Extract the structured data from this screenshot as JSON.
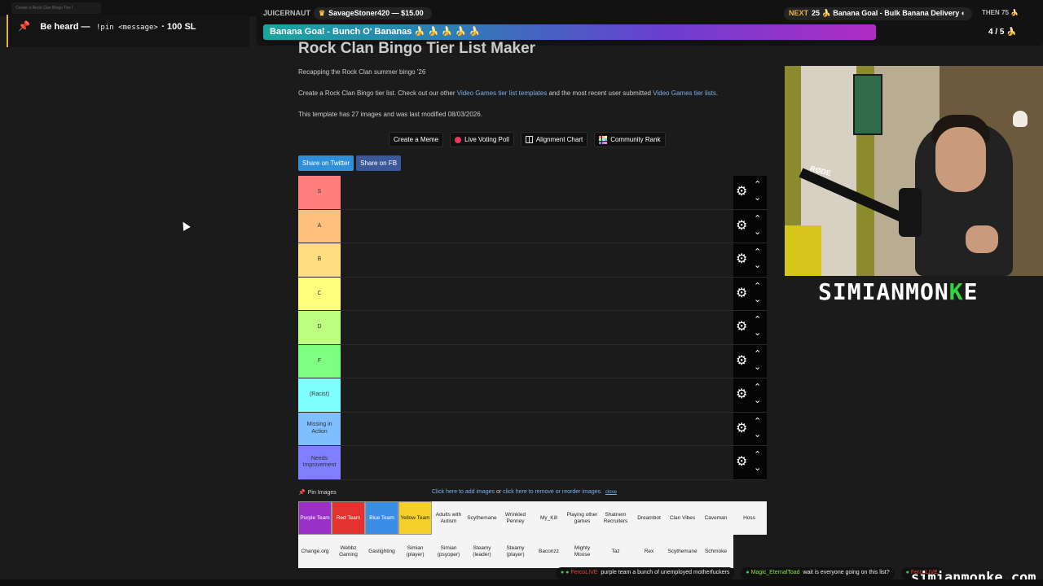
{
  "browser": {
    "tab_title": "Create a Rock Clan Bingo Tier l"
  },
  "pin": {
    "label": "Be heard —",
    "command": "!pin <message>",
    "cost": "· 100 SL"
  },
  "stream_bar": {
    "juice_label": "JUICERNAUT",
    "juice_user": "SavageStoner420 — $15.00",
    "next_tag": "NEXT",
    "next_text": "25 🍌 Banana Goal - Bulk Banana Delivery ◐",
    "then_text": "THEN   75 🍌",
    "goal_text": "Banana Goal - Bunch O' Bananas 🍌 🍌 🍌 🍌 🍌",
    "goal_count": "4 / 5 🍌",
    "goal_progress": 0.8
  },
  "page": {
    "title": "Rock Clan Bingo Tier List Maker",
    "subtitle": "Recapping the Rock Clan summer bingo '26",
    "desc_1": "Create a Rock Clan Bingo tier list. Check out our other ",
    "desc_link_1": "Video Games tier list templates",
    "desc_2": " and the most recent user submitted ",
    "desc_link_2": "Video Games tier lists",
    "desc_3": ".",
    "meta": "This template has 27 images and was last modified 08/03/2026."
  },
  "actions": {
    "create_meme": "Create a Meme",
    "live_poll": "Live Voting Poll",
    "alignment": "Alignment Chart",
    "community": "Community Rank"
  },
  "share": {
    "twitter": "Share on Twitter",
    "fb": "Share on FB"
  },
  "tiers": [
    {
      "label": "S",
      "color": "#ff7f7f"
    },
    {
      "label": "A",
      "color": "#ffbf7f"
    },
    {
      "label": "B",
      "color": "#ffdf7f"
    },
    {
      "label": "C",
      "color": "#ffff7f"
    },
    {
      "label": "D",
      "color": "#bfff7f"
    },
    {
      "label": "F",
      "color": "#7fff7f"
    },
    {
      "label": "(Racist)",
      "color": "#7fffff"
    },
    {
      "label": "Missing in Action",
      "color": "#7fbfff"
    },
    {
      "label": "Needs Improvement",
      "color": "#7f7fff"
    }
  ],
  "icons": {
    "gear": "gear-icon",
    "up": "chevron-up-icon",
    "down": "chevron-down-icon",
    "pin": "pin-icon"
  },
  "bank": {
    "pin_label": "Pin Images",
    "add_link": "Click here to add images",
    "or": " or ",
    "reorder_link": "click here to remove or reorder images.",
    "close": "close",
    "row1": [
      {
        "label": "Purple Team",
        "color": "#9b30c9"
      },
      {
        "label": "Red Team",
        "color": "#e4332f"
      },
      {
        "label": "Blue Team",
        "color": "#3b8ee6"
      },
      {
        "label": "Yellow Team",
        "color": "#f5d02a"
      },
      {
        "label": "Adults with Autism",
        "color": ""
      },
      {
        "label": "Scythemane",
        "color": ""
      },
      {
        "label": "Wrinkled Penney",
        "color": ""
      },
      {
        "label": "My_Kill",
        "color": ""
      },
      {
        "label": "Playing other games",
        "color": ""
      },
      {
        "label": "Shatnem Recruiters",
        "color": ""
      },
      {
        "label": "Dreambot",
        "color": ""
      },
      {
        "label": "Clan Vibes",
        "color": ""
      },
      {
        "label": "Caveman",
        "color": ""
      },
      {
        "label": "Hoss",
        "color": ""
      }
    ],
    "row2": [
      "Change.org",
      "Webbz Gaming",
      "Gaslighting",
      "Simian (player)",
      "Simian (psyoper)",
      "Steamy (leader)",
      "Steamy (player)",
      "Baconzz",
      "Mighty Moose",
      "Taz",
      "Rex",
      "Scythemane",
      "Schmoke"
    ]
  },
  "webcam": {
    "mic_brand": "RØDE"
  },
  "brand": {
    "main": "SIMIANMON",
    "accent": "K",
    "end": "E",
    "site": "simianmonke.com"
  },
  "ticker": [
    {
      "user": "FercoLIVE",
      "msg": "purple team a bunch of unemployed motherfuckers"
    },
    {
      "user": "Magic_EternalToad",
      "msg": "wait is everyone going on this list?"
    },
    {
      "user": "FercoLIVE",
      "msg": ""
    }
  ]
}
